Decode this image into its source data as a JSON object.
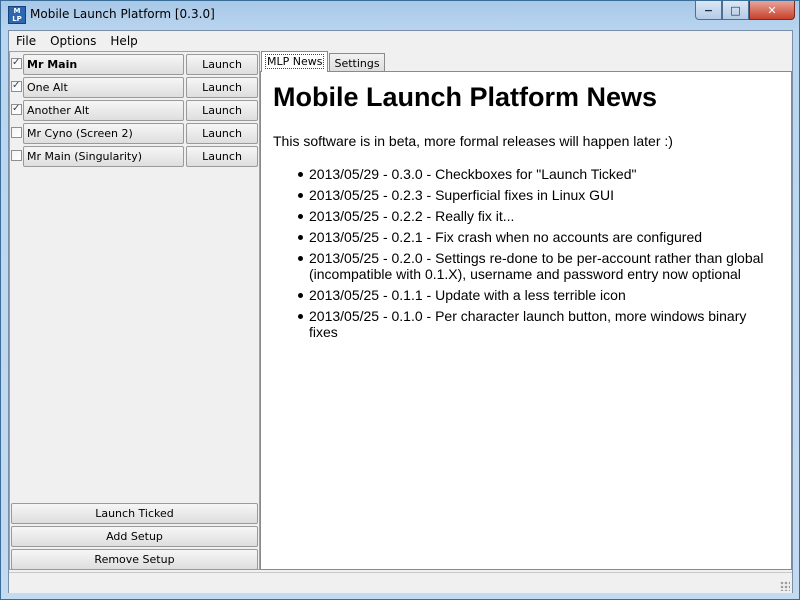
{
  "window": {
    "title": "Mobile Launch Platform [0.3.0]",
    "icon": "MLP-app-icon",
    "controls": {
      "minimize": "−",
      "maximize": "□",
      "close": "✕"
    }
  },
  "menu": {
    "items": [
      "File",
      "Options",
      "Help"
    ]
  },
  "accounts": [
    {
      "name": "Mr Main",
      "checked": true,
      "bold": true,
      "launch_label": "Launch"
    },
    {
      "name": "One Alt",
      "checked": true,
      "bold": false,
      "launch_label": "Launch"
    },
    {
      "name": "Another Alt",
      "checked": true,
      "bold": false,
      "launch_label": "Launch"
    },
    {
      "name": "Mr Cyno (Screen 2)",
      "checked": false,
      "bold": false,
      "launch_label": "Launch"
    },
    {
      "name": "Mr Main (Singularity)",
      "checked": false,
      "bold": false,
      "launch_label": "Launch"
    }
  ],
  "bottom_buttons": [
    "Launch Ticked",
    "Add Setup",
    "Remove Setup"
  ],
  "tabs": [
    {
      "label": "MLP News",
      "active": true
    },
    {
      "label": "Settings",
      "active": false
    }
  ],
  "news": {
    "title": "Mobile Launch Platform News",
    "intro": "This software is in beta, more formal releases will happen later :)",
    "items": [
      "2013/05/29 - 0.3.0 - Checkboxes for \"Launch Ticked\"",
      "2013/05/25 - 0.2.3 - Superficial fixes in Linux GUI",
      "2013/05/25 - 0.2.2 - Really fix it...",
      "2013/05/25 - 0.2.1 - Fix crash when no accounts are configured",
      "2013/05/25 - 0.2.0 - Settings re-done to be per-account rather than global\n(incompatible with 0.1.X), username and password entry now optional",
      "2013/05/25 - 0.1.1 - Update with a less terrible icon",
      "2013/05/25 - 0.1.0 - Per character launch button, more windows binary fixes"
    ]
  }
}
